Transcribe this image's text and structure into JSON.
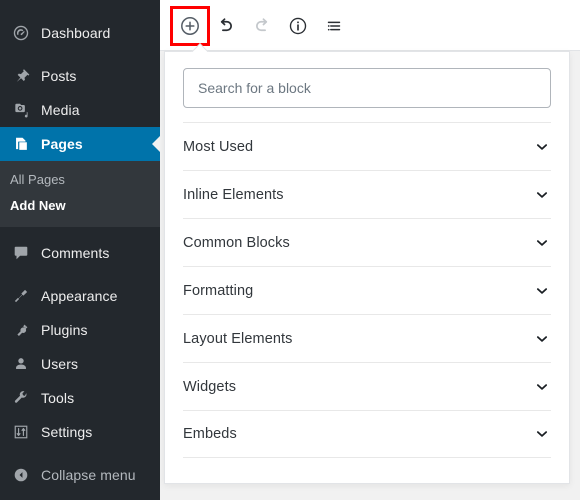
{
  "sidebar": {
    "items": [
      {
        "label": "Dashboard",
        "icon": "dashboard-icon",
        "active": false
      },
      {
        "label": "Posts",
        "icon": "pin-icon",
        "active": false
      },
      {
        "label": "Media",
        "icon": "media-icon",
        "active": false
      },
      {
        "label": "Pages",
        "icon": "pages-icon",
        "active": true
      },
      {
        "label": "Comments",
        "icon": "comments-icon",
        "active": false
      },
      {
        "label": "Appearance",
        "icon": "appearance-icon",
        "active": false
      },
      {
        "label": "Plugins",
        "icon": "plugins-icon",
        "active": false
      },
      {
        "label": "Users",
        "icon": "users-icon",
        "active": false
      },
      {
        "label": "Tools",
        "icon": "tools-icon",
        "active": false
      },
      {
        "label": "Settings",
        "icon": "settings-icon",
        "active": false
      }
    ],
    "submenu": {
      "all_pages": "All Pages",
      "add_new": "Add New"
    },
    "collapse": {
      "label": "Collapse menu",
      "icon": "collapse-arrow-icon"
    },
    "colors": {
      "background": "#23282d",
      "submenu_background": "#32373c",
      "active_background": "#0073aa",
      "text": "#eeeeee",
      "muted_text": "#b4b9be"
    }
  },
  "toolbar": {
    "buttons": [
      {
        "name": "add-block-button",
        "icon": "plus-circle-icon",
        "state": "highlighted"
      },
      {
        "name": "undo-button",
        "icon": "undo-icon",
        "state": "enabled"
      },
      {
        "name": "redo-button",
        "icon": "redo-icon",
        "state": "disabled"
      },
      {
        "name": "content-info-button",
        "icon": "info-circle-icon",
        "state": "enabled"
      },
      {
        "name": "block-navigation-button",
        "icon": "list-view-icon",
        "state": "enabled"
      }
    ],
    "highlight_color": "#ff0000"
  },
  "inserter": {
    "search": {
      "placeholder": "Search for a block",
      "value": ""
    },
    "categories": [
      {
        "label": "Most Used",
        "expanded": false
      },
      {
        "label": "Inline Elements",
        "expanded": false
      },
      {
        "label": "Common Blocks",
        "expanded": false
      },
      {
        "label": "Formatting",
        "expanded": false
      },
      {
        "label": "Layout Elements",
        "expanded": false
      },
      {
        "label": "Widgets",
        "expanded": false
      },
      {
        "label": "Embeds",
        "expanded": false
      }
    ],
    "chevron_icon": "chevron-down-icon"
  }
}
